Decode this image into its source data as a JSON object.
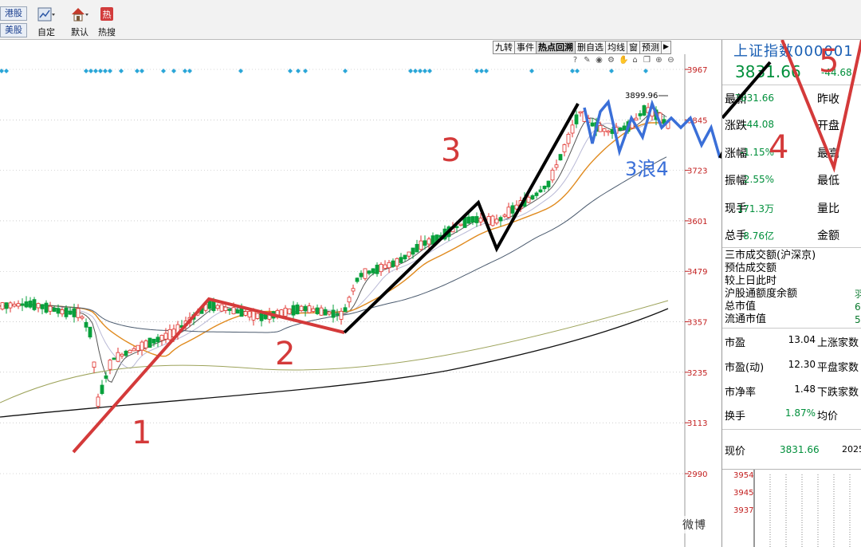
{
  "toolbar": {
    "hk_label": "港股",
    "us_label": "美股",
    "tools": [
      {
        "label": "自定",
        "icon": "custom-chart-icon"
      },
      {
        "label": "默认",
        "icon": "home-icon"
      },
      {
        "label": "热搜",
        "icon": "hot-search-icon"
      }
    ]
  },
  "chart": {
    "tabs": [
      "九转",
      "事件",
      "热点回溯",
      "删自选",
      "均线",
      "窗",
      "预测"
    ],
    "active_tab": "热点回溯",
    "tool_icons": [
      "question-icon",
      "pen-icon",
      "eye-icon",
      "gear-icon",
      "hand-icon",
      "lock-icon",
      "copy-icon",
      "zoom-in-icon",
      "zoom-out-icon"
    ],
    "price_ticks": [
      "3967",
      "3845",
      "3723",
      "3601",
      "3479",
      "3357",
      "3235",
      "3113",
      "2990"
    ],
    "peak_label": "3899.96",
    "annotations": {
      "wave1": "1",
      "wave2": "2",
      "wave3": "3",
      "wave4": "4",
      "wave5": "5",
      "sub_wave4": "3浪4"
    },
    "colors": {
      "up": "#e0312c",
      "down": "#08a03c",
      "ma5": "#555555",
      "ma10": "#b9b9d6",
      "ma20": "#e08a1e",
      "ma60": "#4a5a6e",
      "ma120": "#9da35b",
      "ma250": "#111111",
      "wave_red": "#d43a3a",
      "wave_black": "#000000",
      "wave_blue": "#3a6fd8",
      "signal": "#2aa6d8"
    }
  },
  "info": {
    "index_title": "上证指数000001",
    "price": "3831.66",
    "change": "-44.68",
    "rows": [
      {
        "label": "最新",
        "value": "3831.66",
        "label2": "昨收"
      },
      {
        "label": "涨跌",
        "value": "-44.08",
        "label2": "开盘"
      },
      {
        "label": "涨幅",
        "value": "-1.15%",
        "label2": "最高"
      },
      {
        "label": "振幅",
        "value": "2.55%",
        "label2": "最低"
      },
      {
        "label": "现手",
        "value": "171.3万",
        "label2": "量比"
      },
      {
        "label": "总手",
        "value": "8.76亿",
        "label2": "金额"
      }
    ],
    "market": [
      {
        "label": "三市成交额(沪深京)",
        "cut": ""
      },
      {
        "label": "预估成交额",
        "cut": ""
      },
      {
        "label": "较上日此时",
        "cut": ""
      },
      {
        "label": "沪股通额度余额",
        "cut": "羽"
      },
      {
        "label": "总市值",
        "cut": "6"
      },
      {
        "label": "流通市值",
        "cut": "5"
      }
    ],
    "valuation": [
      {
        "label": "市盈",
        "value": "13.04",
        "label2": "上涨家数"
      },
      {
        "label": "市盈(动)",
        "value": "12.30",
        "label2": "平盘家数"
      },
      {
        "label": "市净率",
        "value": "1.48",
        "label2": "下跌家数"
      },
      {
        "label": "换手",
        "value": "1.87%",
        "label2": "均价"
      }
    ],
    "current_label": "现价",
    "current_value": "3831.66",
    "current_date": "2025",
    "mini_ticks": [
      "3954",
      "3945",
      "3937"
    ]
  },
  "watermark": "微博"
}
